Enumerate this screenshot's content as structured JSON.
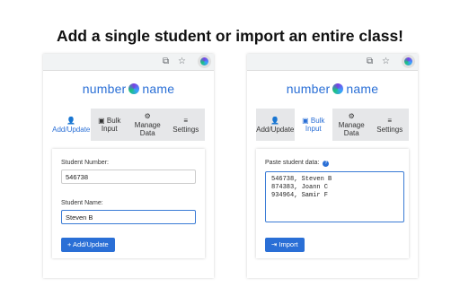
{
  "headline": "Add a single student or import an entire class!",
  "brand": {
    "left": "number",
    "right": "name"
  },
  "tabs": [
    {
      "label1": "Add/Update",
      "label2": "",
      "icon": "add-user-icon"
    },
    {
      "label1": "Bulk",
      "label2": "Input",
      "icon": "bulk-input-icon"
    },
    {
      "label1": "Manage",
      "label2": "Data",
      "icon": "manage-data-icon"
    },
    {
      "label1": "Settings",
      "label2": "",
      "icon": "settings-icon"
    }
  ],
  "left": {
    "student_number_label": "Student Number:",
    "student_number_value": "546738",
    "student_name_label": "Student Name:",
    "student_name_value": "Steven B",
    "add_update_button": "+ Add/Update"
  },
  "right": {
    "paste_label": "Paste student data:",
    "paste_lines": [
      "546738, Steven B",
      "874383, Joann C",
      "934964, Samir F"
    ],
    "import_button": "Import"
  },
  "colors": {
    "accent": "#2a6fd6",
    "tab_bg": "#e6e7e9"
  }
}
